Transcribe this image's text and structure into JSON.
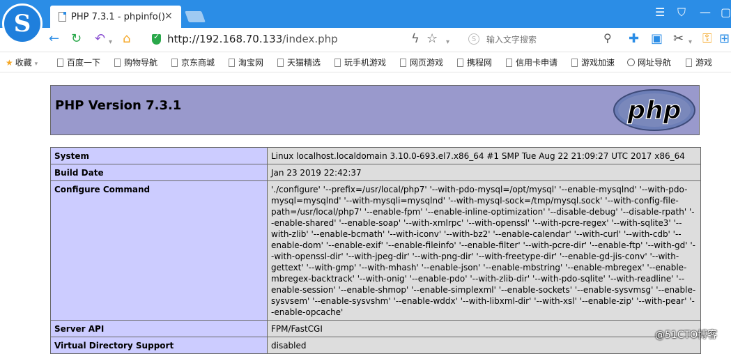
{
  "browser": {
    "tab_title": "PHP 7.3.1 - phpinfo()",
    "tab_close": "×",
    "url_host": "http://192.168.70.133",
    "url_path": "/index.php",
    "search_placeholder": "输入文字搜索",
    "icons": {
      "back": "back-arrow-icon",
      "reload": "reload-icon",
      "undo": "undo-icon",
      "home": "home-icon",
      "security": "shield-icon",
      "lightning": "lightning-icon",
      "favorite": "star-icon",
      "search": "magnifier-icon",
      "extension": "puzzle-icon",
      "cut": "scissors-icon",
      "key": "key-icon"
    },
    "accent": "#2b8de6"
  },
  "bookmarks": [
    "收藏",
    "百度一下",
    "购物导航",
    "京东商城",
    "淘宝网",
    "天猫精选",
    "玩手机游戏",
    "网页游戏",
    "携程网",
    "信用卡申请",
    "游戏加速",
    "网址导航",
    "游戏"
  ],
  "page": {
    "header_title": "PHP Version 7.3.1",
    "logo_text": "php",
    "header_bg": "#9999cc",
    "rows": [
      {
        "key": "System",
        "value": "Linux localhost.localdomain 3.10.0-693.el7.x86_64 #1 SMP Tue Aug 22 21:09:27 UTC 2017 x86_64"
      },
      {
        "key": "Build Date",
        "value": "Jan 23 2019 22:42:37"
      },
      {
        "key": "Configure Command",
        "value": "'./configure' '--prefix=/usr/local/php7' '--with-pdo-mysql=/opt/mysql' '--enable-mysqlnd' '--with-pdo-mysql=mysqlnd' '--with-mysqli=mysqlnd' '--with-mysql-sock=/tmp/mysql.sock' '--with-config-file-path=/usr/local/php7' '--enable-fpm' '--enable-inline-optimization' '--disable-debug' '--disable-rpath' '--enable-shared' '--enable-soap' '--with-xmlrpc' '--with-openssl' '--with-pcre-regex' '--with-sqlite3' '--with-zlib' '--enable-bcmath' '--with-iconv' '--with-bz2' '--enable-calendar' '--with-curl' '--with-cdb' '--enable-dom' '--enable-exif' '--enable-fileinfo' '--enable-filter' '--with-pcre-dir' '--enable-ftp' '--with-gd' '--with-openssl-dir' '--with-jpeg-dir' '--with-png-dir' '--with-freetype-dir' '--enable-gd-jis-conv' '--with-gettext' '--with-gmp' '--with-mhash' '--enable-json' '--enable-mbstring' '--enable-mbregex' '--enable-mbregex-backtrack' '--with-onig' '--enable-pdo' '--with-zlib-dir' '--with-pdo-sqlite' '--with-readline' '--enable-session' '--enable-shmop' '--enable-simplexml' '--enable-sockets' '--enable-sysvmsg' '--enable-sysvsem' '--enable-sysvshm' '--enable-wddx' '--with-libxml-dir' '--with-xsl' '--enable-zip' '--with-pear' '--enable-opcache'"
      },
      {
        "key": "Server API",
        "value": "FPM/FastCGI"
      },
      {
        "key": "Virtual Directory Support",
        "value": "disabled"
      }
    ]
  },
  "watermark": "@51CTO博客"
}
